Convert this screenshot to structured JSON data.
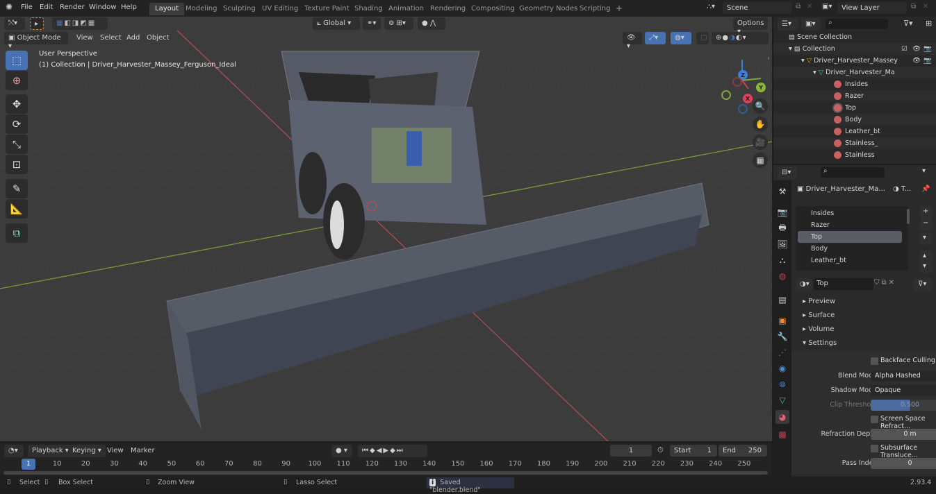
{
  "topbar": {
    "menus": [
      "File",
      "Edit",
      "Render",
      "Window",
      "Help"
    ],
    "workspaces": [
      "Layout",
      "Modeling",
      "Sculpting",
      "UV Editing",
      "Texture Paint",
      "Shading",
      "Animation",
      "Rendering",
      "Compositing",
      "Geometry Nodes",
      "Scripting"
    ],
    "active_workspace": "Layout",
    "add_workspace": "+",
    "scene": "Scene",
    "view_layer": "View Layer"
  },
  "viewport": {
    "mode": "Object Mode",
    "menus": [
      "View",
      "Select",
      "Add",
      "Object"
    ],
    "transform_orientation": "Global",
    "options_label": "Options",
    "overlay_line1": "User Perspective",
    "overlay_line2": "(1) Collection | Driver_Harvester_Massey_Ferguson_Ideal",
    "gizmo_axes": [
      "Z",
      "Y",
      "X"
    ],
    "tools": [
      "select-box",
      "cursor",
      "move",
      "rotate",
      "scale",
      "transform",
      "annotate",
      "measure",
      "add-cube"
    ],
    "nav_buttons": [
      "zoom",
      "pan",
      "camera",
      "ortho-grid"
    ],
    "axis_colors": {
      "x": "#c2445c",
      "y": "#7fa83a",
      "z": "#3f7fd8"
    }
  },
  "outliner": {
    "scene_collection": "Scene Collection",
    "collection": "Collection",
    "object": "Driver_Harvester_Massey",
    "mesh": "Driver_Harvester_Ma",
    "materials": [
      "Insides",
      "Razer",
      "Top",
      "Body",
      "Leather_bt",
      "Stainless_",
      "Stainless"
    ],
    "selected_material": "Top"
  },
  "properties": {
    "object_name": "Driver_Harvester_Ma...",
    "material_short": "T...",
    "material_slots": [
      "Insides",
      "Razer",
      "Top",
      "Body",
      "Leather_bt"
    ],
    "active_slot": "Top",
    "material_name": "Top",
    "sections": [
      "Preview",
      "Surface",
      "Volume",
      "Settings"
    ],
    "settings": {
      "backface_culling": "Backface Culling",
      "blend_mode_label": "Blend Mode",
      "blend_mode": "Alpha Hashed",
      "shadow_mode_label": "Shadow Mode",
      "shadow_mode": "Opaque",
      "clip_threshold_label": "Clip Threshold",
      "clip_threshold": "0.500",
      "screen_space_refraction": "Screen Space Refract...",
      "refraction_depth_label": "Refraction Depth",
      "refraction_depth": "0 m",
      "subsurface_translucency": "Subsurface Transluce...",
      "pass_index_label": "Pass Index",
      "pass_index": "0"
    }
  },
  "timeline": {
    "menus": [
      "Playback",
      "Keying",
      "View",
      "Marker"
    ],
    "current_frame": "1",
    "start_label": "Start",
    "start": "1",
    "end_label": "End",
    "end": "250",
    "ticks": [
      "1",
      "10",
      "20",
      "30",
      "40",
      "50",
      "60",
      "70",
      "80",
      "90",
      "100",
      "110",
      "120",
      "130",
      "140",
      "150",
      "160",
      "170",
      "180",
      "190",
      "200",
      "210",
      "220",
      "230",
      "240",
      "250"
    ]
  },
  "statusbar": {
    "select": "Select",
    "box_select": "Box Select",
    "zoom_view": "Zoom View",
    "lasso_select": "Lasso Select",
    "message": "Saved \"blender.blend\"",
    "version": "2.93.4"
  }
}
